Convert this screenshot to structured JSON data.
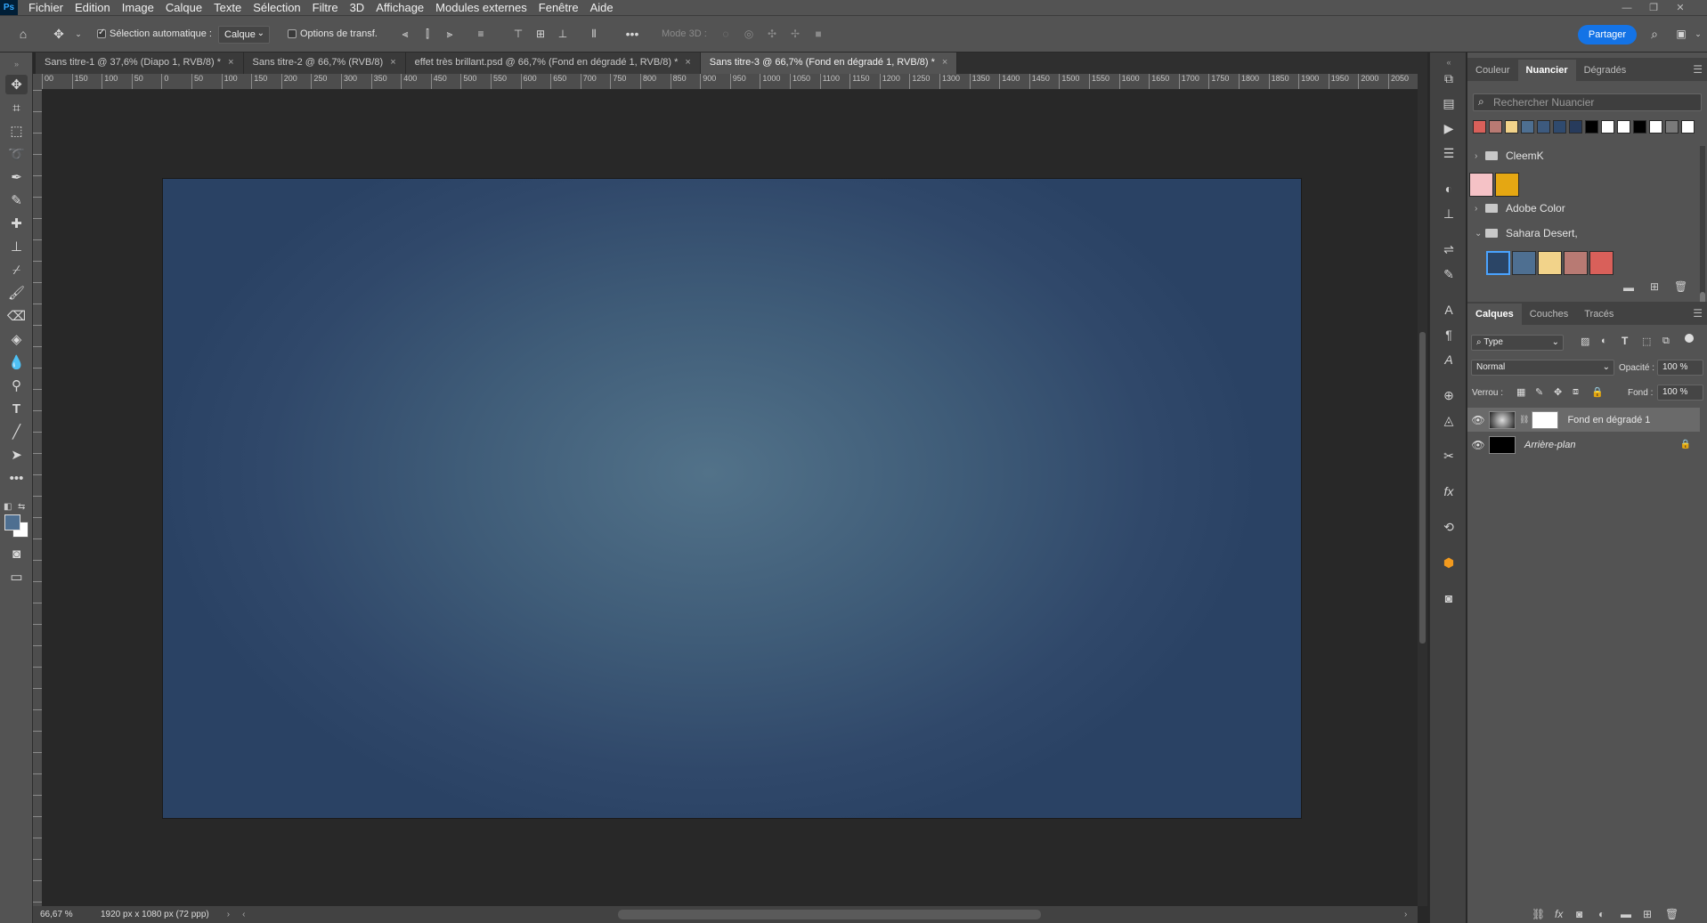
{
  "app": {
    "logo": "Ps"
  },
  "menubar": {
    "items": [
      "Fichier",
      "Edition",
      "Image",
      "Calque",
      "Texte",
      "Sélection",
      "Filtre",
      "3D",
      "Affichage",
      "Modules externes",
      "Fenêtre",
      "Aide"
    ]
  },
  "options": {
    "auto_select_label": "Sélection automatique :",
    "auto_select_value": "Calque",
    "transform_label": "Options de transf.",
    "mode3d_label": "Mode 3D :",
    "share_label": "Partager"
  },
  "tabs": [
    {
      "label": "Sans titre-1 @ 37,6% (Diapo 1, RVB/8) *",
      "active": false
    },
    {
      "label": "Sans titre-2 @ 66,7% (RVB/8)",
      "active": false
    },
    {
      "label": "effet très brillant.psd @ 66,7% (Fond en dégradé 1, RVB/8) *",
      "active": false
    },
    {
      "label": "Sans titre-3 @ 66,7% (Fond en dégradé 1, RVB/8) *",
      "active": true
    }
  ],
  "ruler": {
    "labels": [
      "00",
      "150",
      "100",
      "50",
      "0",
      "50",
      "100",
      "150",
      "200",
      "250",
      "300",
      "350",
      "400",
      "450",
      "500",
      "550",
      "600",
      "650",
      "700",
      "750",
      "800",
      "850",
      "900",
      "950",
      "1000",
      "1050",
      "1100",
      "1150",
      "1200",
      "1250",
      "1300",
      "1350",
      "1400",
      "1450",
      "1500",
      "1550",
      "1600",
      "1650",
      "1700",
      "1750",
      "1800",
      "1850",
      "1900",
      "1950",
      "2000",
      "2050"
    ]
  },
  "status": {
    "zoom": "66,67 %",
    "doc_info": "1920 px x 1080 px (72 ppp)"
  },
  "swatch_panel": {
    "tabs": [
      "Couleur",
      "Nuancier",
      "Dégradés"
    ],
    "active_tab": "Nuancier",
    "search_placeholder": "Rechercher Nuancier",
    "recent_colors": [
      "#d9605a",
      "#b87a73",
      "#f2d38a",
      "#4e6f91",
      "#3d5a7e",
      "#2f4a6e",
      "#273b5c",
      "#000000",
      "#ffffff",
      "#ffffff",
      "#000000",
      "#ffffff",
      "#7a7a7a",
      "#ffffff"
    ],
    "folders": [
      {
        "name": "CleemK",
        "colors": [
          "#f5c2c6",
          "#e5a712"
        ],
        "expanded": false
      },
      {
        "name": "Adobe Color",
        "colors": [],
        "expanded": false
      },
      {
        "name": "Sahara Desert,",
        "colors": [
          "#2b4566",
          "#4e6f91",
          "#f2d38a",
          "#b87a73",
          "#d9605a"
        ],
        "expanded": true
      }
    ]
  },
  "layers_panel": {
    "tabs": [
      "Calques",
      "Couches",
      "Tracés"
    ],
    "active_tab": "Calques",
    "filter_value": "Type",
    "blend_mode": "Normal",
    "opacity_label": "Opacité :",
    "opacity_value": "100 %",
    "lock_label": "Verrou :",
    "fill_label": "Fond :",
    "fill_value": "100 %",
    "layers": [
      {
        "name": "Fond en dégradé 1",
        "selected": true
      },
      {
        "name": "Arrière-plan",
        "selected": false,
        "locked": true
      }
    ]
  }
}
